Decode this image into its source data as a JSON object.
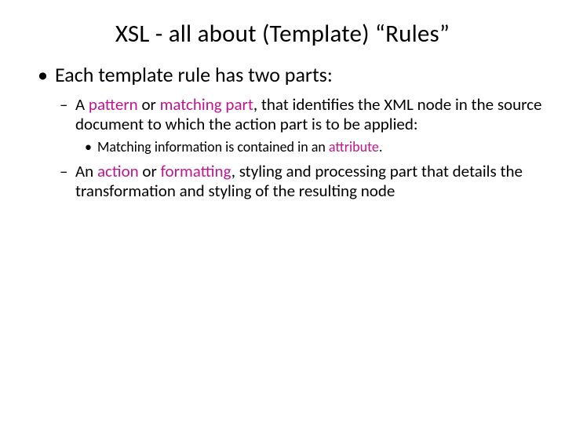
{
  "title": "XSL - all about (Template) “Rules”",
  "bullet1_text": "Each template rule has two parts:",
  "sub1": {
    "pre": "A ",
    "hl1": "pattern",
    "mid1": " or  ",
    "hl2": "matching part",
    "rest": ", that identifies the XML node in the source document to which the action part is to be applied:"
  },
  "sub1_sub": {
    "pre": "Matching information is contained in an ",
    "hl": "attribute",
    "post": "."
  },
  "sub2": {
    "pre": "An ",
    "hl1": "action",
    "mid1": " or ",
    "hl2": "formatting",
    "rest": ", styling and processing part that details the transformation and styling of the resulting node"
  }
}
